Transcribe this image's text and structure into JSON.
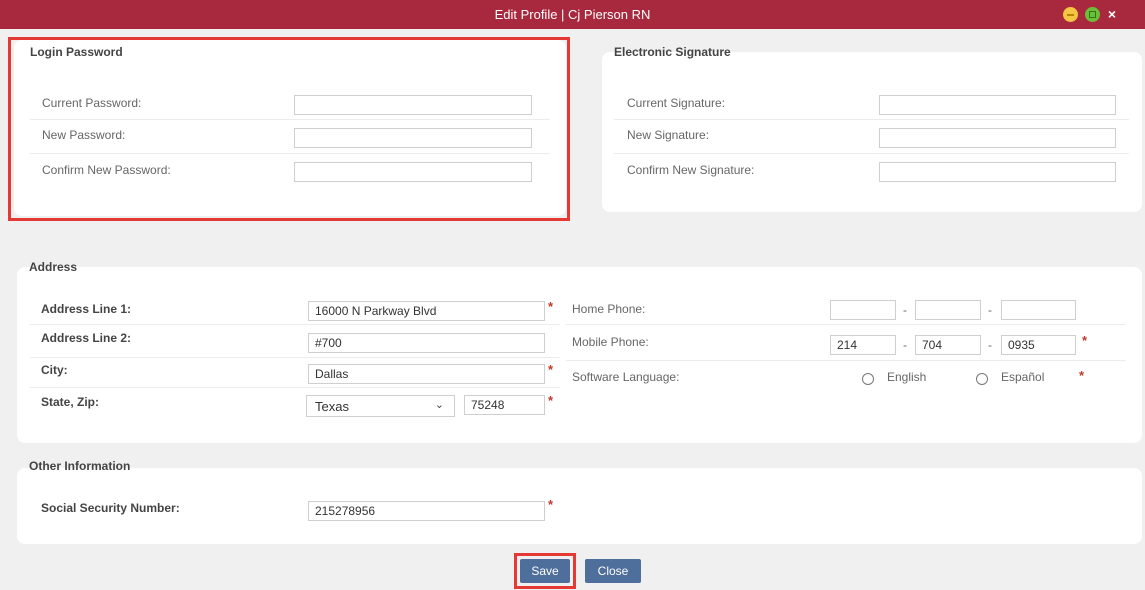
{
  "window": {
    "title": "Edit Profile | Cj Pierson RN",
    "minimize_icon": "minimize-icon",
    "maximize_icon": "maximize-icon",
    "close_icon": "close-icon",
    "close_glyph": "×"
  },
  "login_password": {
    "title": "Login Password",
    "current_label": "Current Password:",
    "new_label": "New Password:",
    "confirm_label": "Confirm New Password:",
    "current_value": "",
    "new_value": "",
    "confirm_value": ""
  },
  "electronic_signature": {
    "title": "Electronic Signature",
    "current_label": "Current Signature:",
    "new_label": "New Signature:",
    "confirm_label": "Confirm New Signature:",
    "current_value": "",
    "new_value": "",
    "confirm_value": ""
  },
  "address": {
    "title": "Address",
    "line1_label": "Address Line 1:",
    "line1_value": "16000 N Parkway Blvd",
    "line2_label": "Address Line 2:",
    "line2_value": "#700",
    "city_label": "City:",
    "city_value": "Dallas",
    "state_zip_label": "State, Zip:",
    "state_value": "Texas",
    "zip_value": "75248",
    "home_phone_label": "Home Phone:",
    "home_phone": [
      "",
      "",
      ""
    ],
    "mobile_phone_label": "Mobile Phone:",
    "mobile_phone": [
      "214",
      "704",
      "0935"
    ],
    "language_label": "Software Language:",
    "language_options": [
      "English",
      "Español"
    ],
    "required_mark": "*",
    "dash": "-"
  },
  "other_information": {
    "title": "Other Information",
    "ssn_label": "Social Security Number:",
    "ssn_value": "215278956"
  },
  "buttons": {
    "save": "Save",
    "close": "Close"
  },
  "colors": {
    "titlebar": "#a8283d",
    "button": "#4e6e9b",
    "highlight": "#e53935",
    "required": "#c0392b"
  }
}
